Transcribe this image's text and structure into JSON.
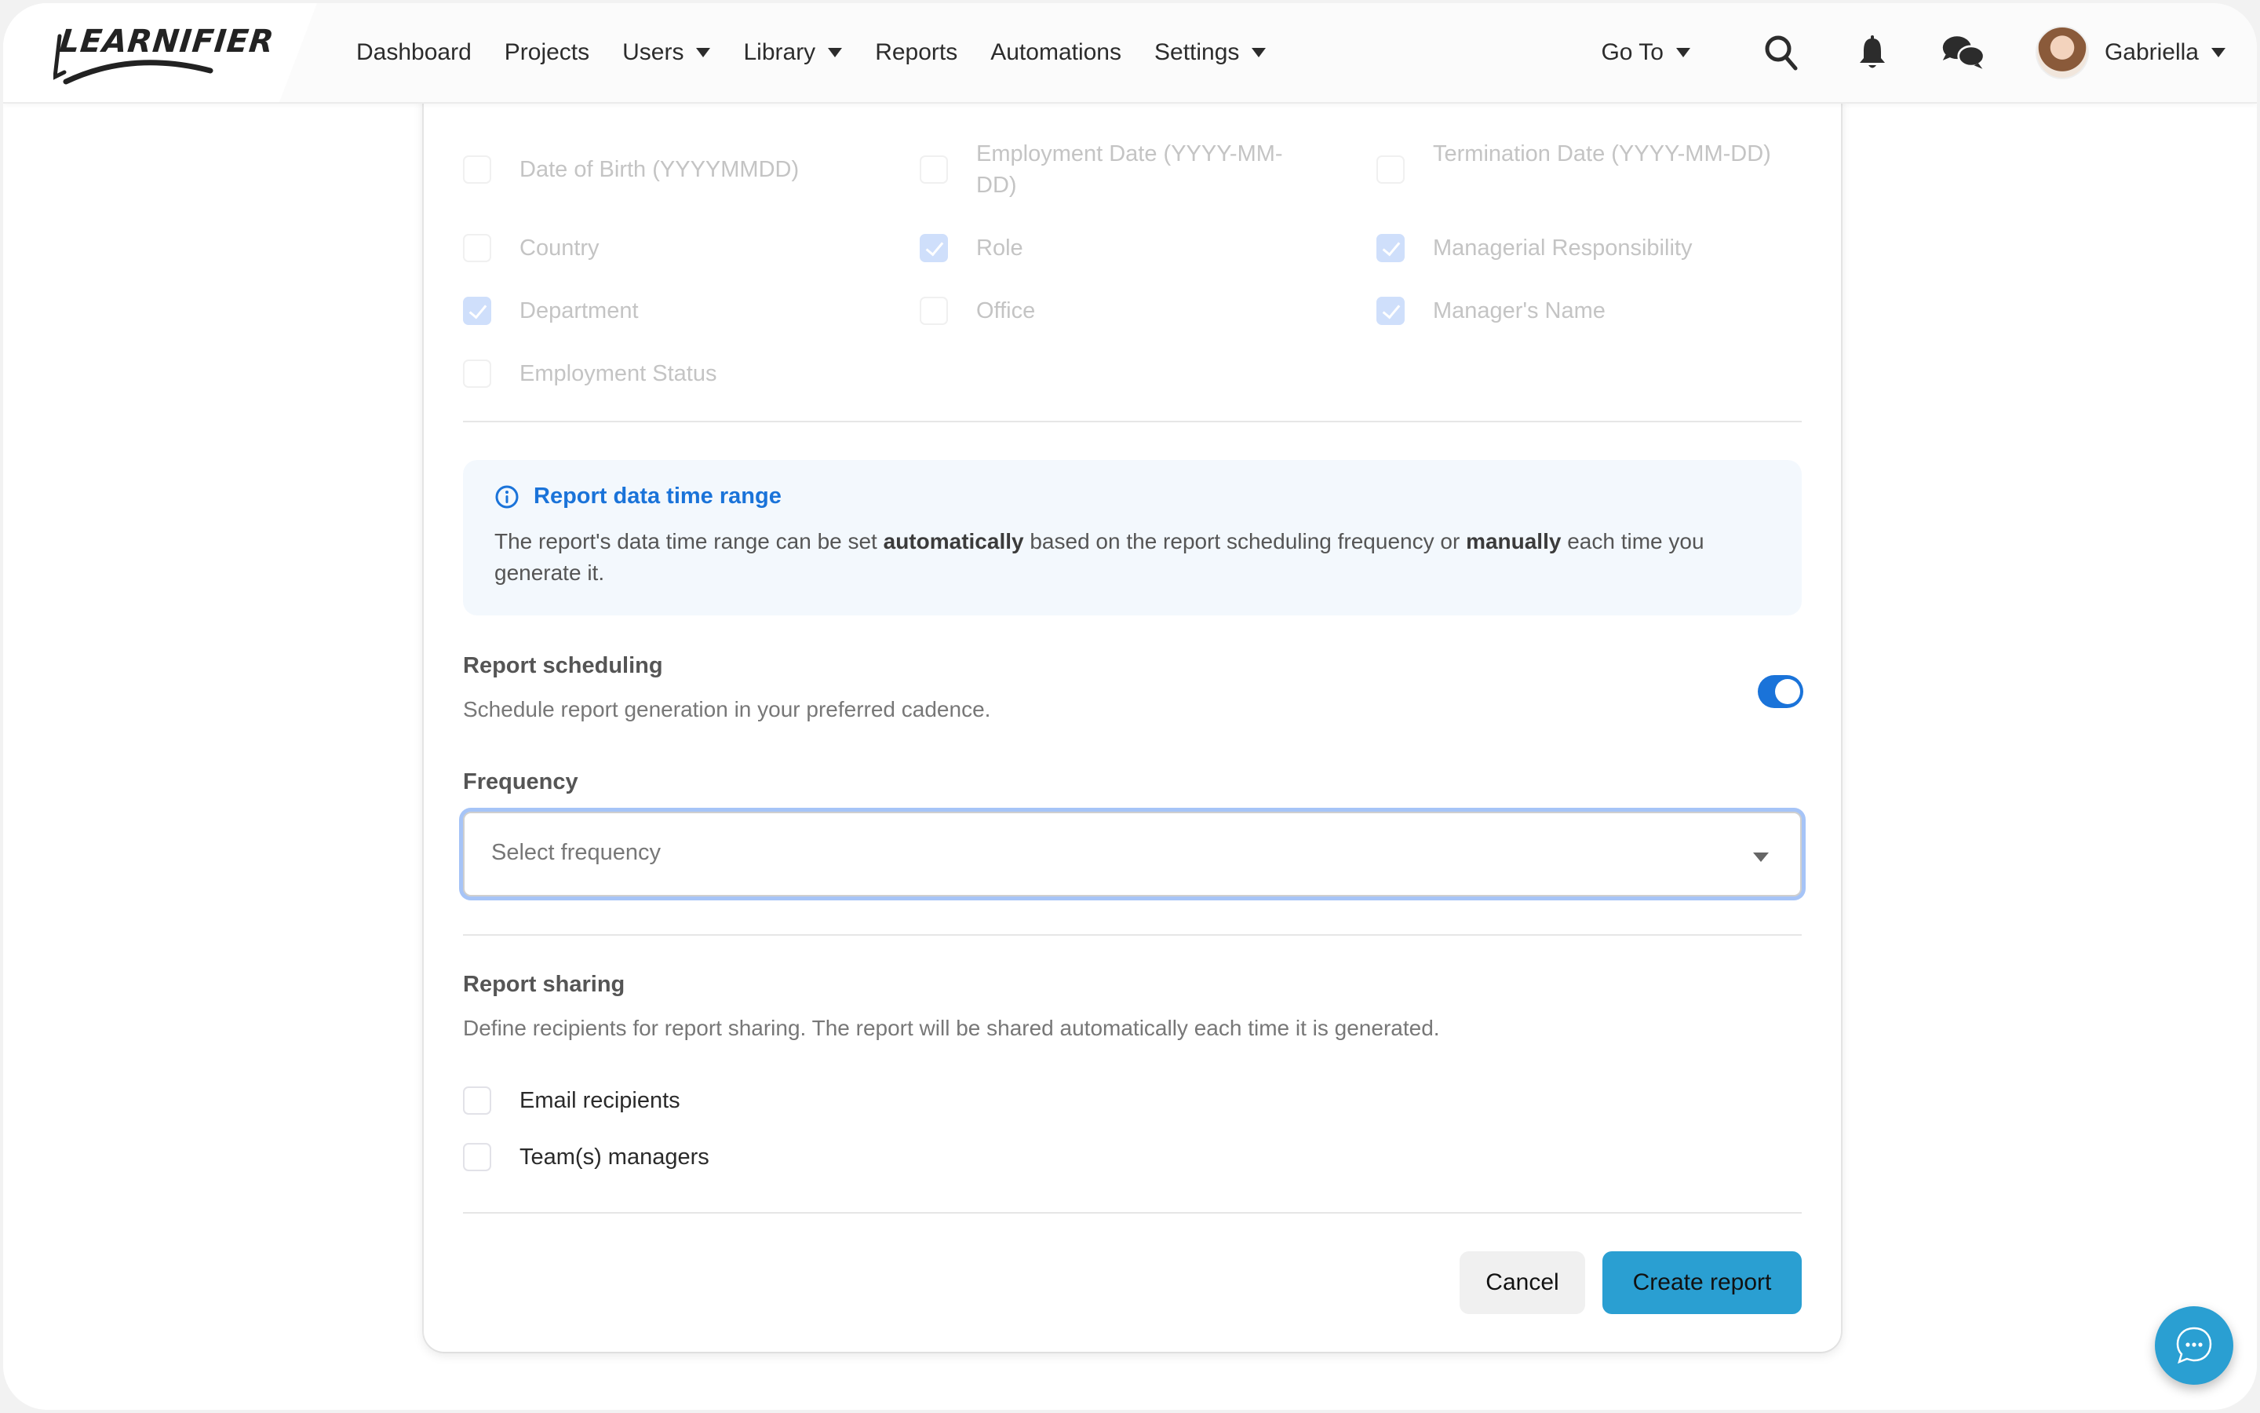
{
  "brand": {
    "logo_text": "LEARNIFIER"
  },
  "nav": {
    "items": [
      {
        "label": "Dashboard",
        "dropdown": false
      },
      {
        "label": "Projects",
        "dropdown": false
      },
      {
        "label": "Users",
        "dropdown": true
      },
      {
        "label": "Library",
        "dropdown": true
      },
      {
        "label": "Reports",
        "dropdown": false
      },
      {
        "label": "Automations",
        "dropdown": false
      },
      {
        "label": "Settings",
        "dropdown": true
      }
    ],
    "goto_label": "Go To",
    "icons": [
      "search-icon",
      "bell-icon",
      "chat-bubbles-icon"
    ],
    "user_name": "Gabriella"
  },
  "fields": {
    "items": [
      {
        "label": "Date of Birth (YYYYMMDD)",
        "checked": false
      },
      {
        "label": "Employment Date (YYYY-MM-DD)",
        "checked": false
      },
      {
        "label": "Termination Date (YYYY-MM-DD)",
        "checked": false
      },
      {
        "label": "Country",
        "checked": false
      },
      {
        "label": "Role",
        "checked": true
      },
      {
        "label": "Managerial Responsibility",
        "checked": true
      },
      {
        "label": "Department",
        "checked": true
      },
      {
        "label": "Office",
        "checked": false
      },
      {
        "label": "Manager's Name",
        "checked": true
      },
      {
        "label": "Employment Status",
        "checked": false
      }
    ]
  },
  "info": {
    "title": "Report data time range",
    "text_1": "The report's data time range can be set ",
    "bold_1": "automatically",
    "text_2": " based on the report scheduling frequency or ",
    "bold_2": "manually",
    "text_3": " each time you generate it."
  },
  "scheduling": {
    "title": "Report scheduling",
    "description": "Schedule report generation in your preferred cadence.",
    "enabled": true,
    "frequency_label": "Frequency",
    "frequency_placeholder": "Select frequency"
  },
  "sharing": {
    "title": "Report sharing",
    "description": "Define recipients for report sharing. The report will be shared automatically each time it is generated.",
    "options": [
      {
        "label": "Email recipients",
        "checked": false
      },
      {
        "label": "Team(s) managers",
        "checked": false
      }
    ]
  },
  "actions": {
    "cancel_label": "Cancel",
    "create_label": "Create report"
  },
  "colors": {
    "accent_blue": "#1a73d9",
    "primary_button": "#2a9fd2",
    "checkbox_checked": "#cfdffb",
    "info_bg": "#f3f8fd"
  }
}
